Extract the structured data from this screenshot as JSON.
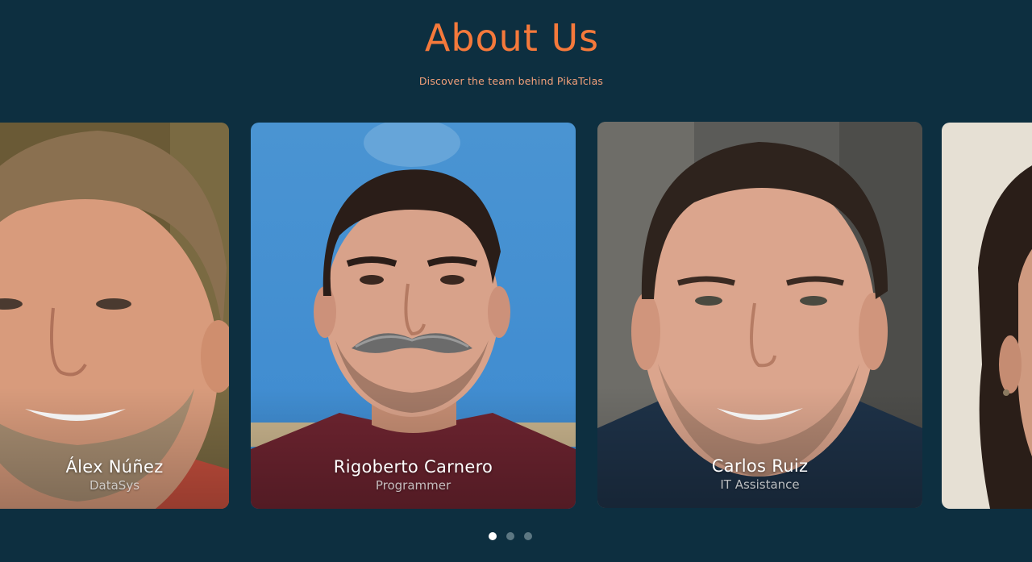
{
  "header": {
    "title": "About Us",
    "subtitle": "Discover the team behind PikaTclas"
  },
  "team": [
    {
      "name": "Álex Núñez",
      "role": "DataSys",
      "photo": "bearded-man-portrait"
    },
    {
      "name": "Rigoberto Carnero",
      "role": "Programmer",
      "photo": "man-with-mustache-portrait"
    },
    {
      "name": "Carlos Ruiz",
      "role": "IT Assistance",
      "photo": "smiling-man-portrait"
    },
    {
      "name": "",
      "role": "",
      "photo": "woman-portrait-partial"
    }
  ],
  "pagination": {
    "total": 3,
    "active_index": 0
  },
  "colors": {
    "background": "#0d2f40",
    "title": "#f5793b",
    "subtitle": "#f3a07a",
    "dot_active": "#ffffff",
    "dot_inactive": "#5c7782"
  }
}
